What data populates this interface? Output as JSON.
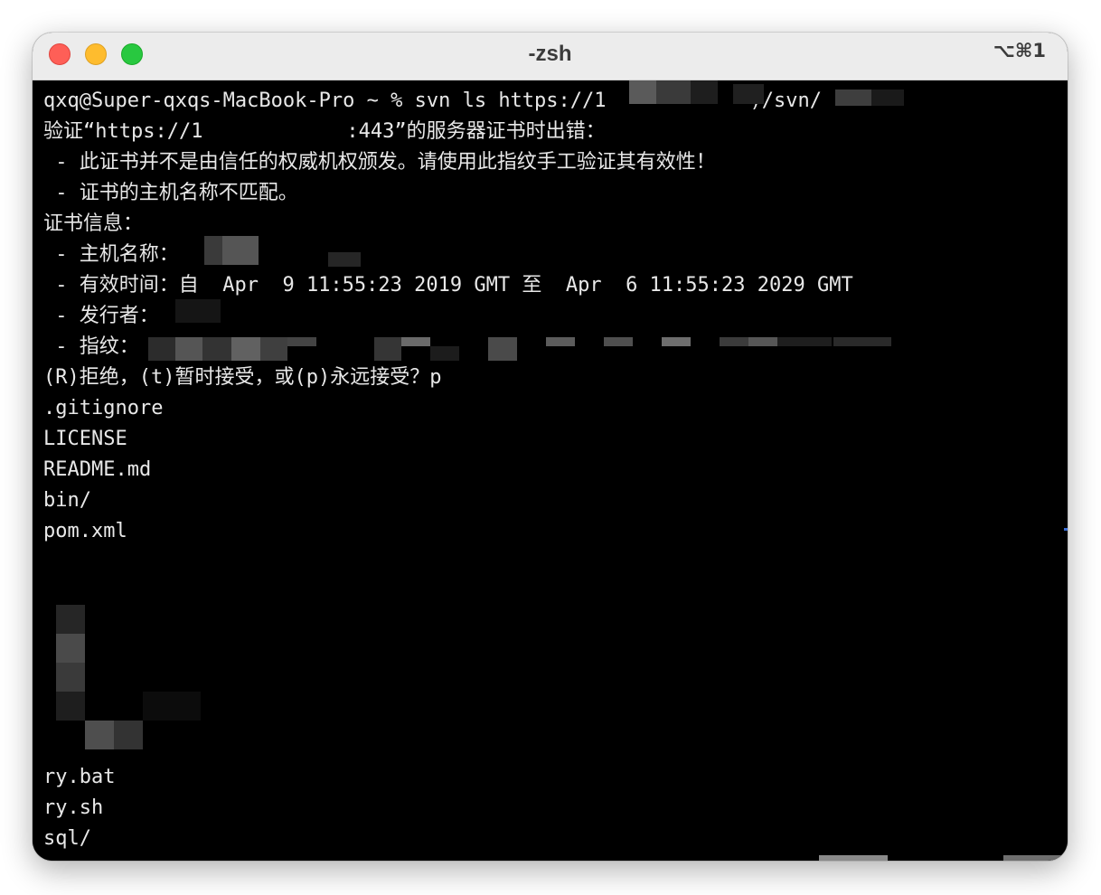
{
  "window": {
    "title": "-zsh",
    "shortcut": "⌥⌘1"
  },
  "terminal": {
    "lines": [
      "qxq@Super-qxqs-MacBook-Pro ~ % svn ls https://1            )/svn/",
      "验证“https://1            :443”的服务器证书时出错：",
      " - 此证书并不是由信任的权威机权颁发。请使用此指纹手工验证其有效性！",
      " - 证书的主机名称不匹配。",
      "证书信息：",
      " - 主机名称：",
      " - 有效时间：自  Apr  9 11:55:23 2019 GMT 至  Apr  6 11:55:23 2029 GMT",
      " - 发行者：",
      " - 指纹：",
      "(R)拒绝，(t)暂时接受，或(p)永远接受？p",
      ".gitignore",
      "LICENSE",
      "README.md",
      "bin/",
      "pom.xml",
      "ry.bat",
      "ry.sh",
      "sql/"
    ]
  },
  "colors": {
    "terminal_bg": "#000000",
    "terminal_fg": "#e8e8e8",
    "titlebar_bg": "#ececec",
    "close": "#fe5f57",
    "minimize": "#febc2e",
    "zoom": "#28c840"
  }
}
